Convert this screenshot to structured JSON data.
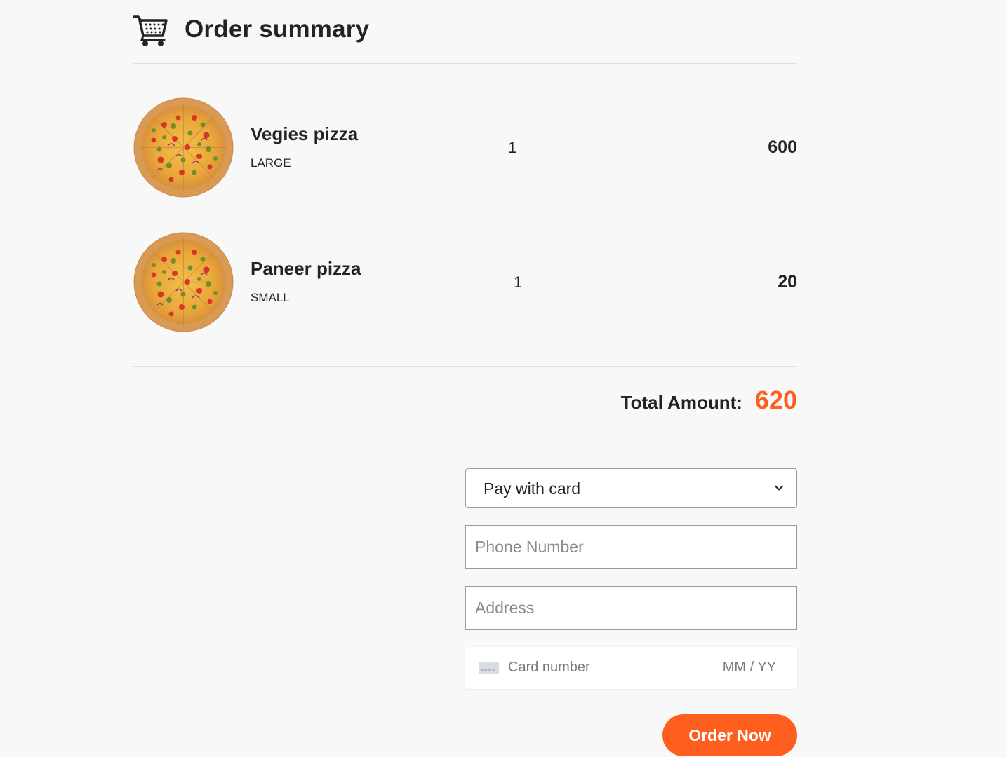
{
  "header": {
    "title": "Order summary",
    "icon": "shopping-cart-icon"
  },
  "items": [
    {
      "name": "Vegies pizza",
      "size": "LARGE",
      "qty": "1",
      "price": "600",
      "image": "pizza-image"
    },
    {
      "name": "Paneer pizza",
      "size": "SMALL",
      "qty": "1",
      "price": "20",
      "image": "pizza-image"
    }
  ],
  "total": {
    "label": "Total Amount:",
    "value": "620"
  },
  "form": {
    "payment_method": "Pay with card",
    "phone_placeholder": "Phone Number",
    "address_placeholder": "Address",
    "card": {
      "number_placeholder": "Card number",
      "expiry_placeholder": "MM / YY",
      "icon": "credit-card-icon"
    },
    "submit_label": "Order Now"
  },
  "colors": {
    "accent": "#fe5f1e",
    "text": "#232323",
    "background": "#f8f8f8"
  }
}
